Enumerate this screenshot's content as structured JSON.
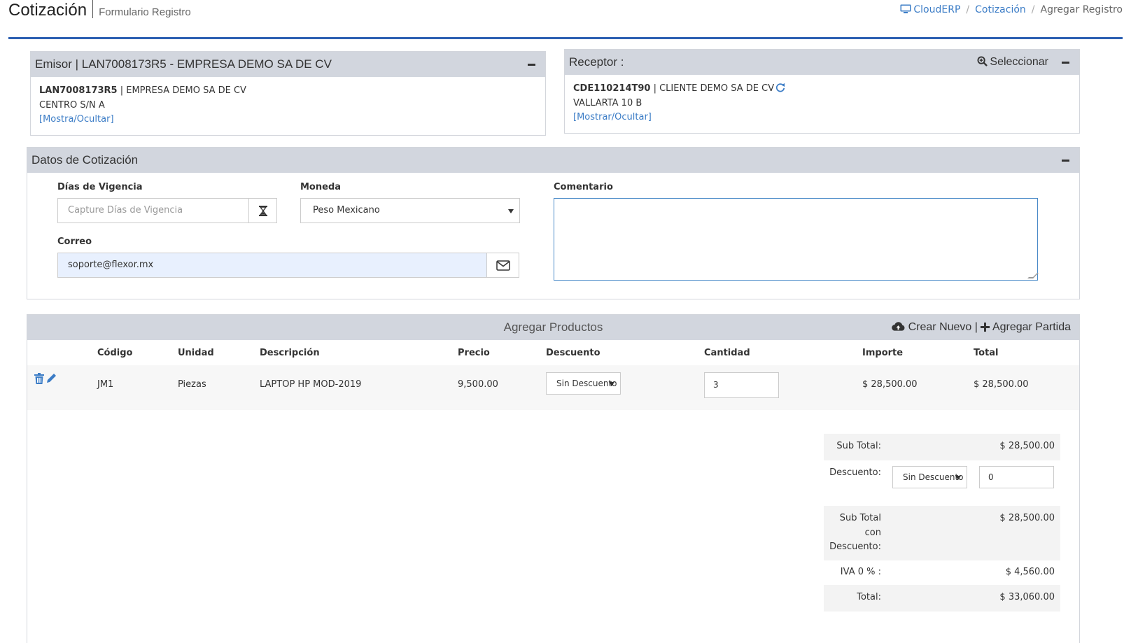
{
  "header": {
    "title": "Cotización",
    "subtitle": "Formulario Registro",
    "breadcrumb": {
      "home": "CloudERP",
      "section": "Cotización",
      "current": "Agregar Registro"
    }
  },
  "emisor": {
    "title": "Emisor | LAN7008173R5 - EMPRESA DEMO SA DE CV",
    "rfc": "LAN7008173R5",
    "name": " | EMPRESA DEMO SA DE CV",
    "address": "CENTRO S/N A",
    "toggle": "[Mostra/Ocultar]"
  },
  "receptor": {
    "title": "Receptor :",
    "select_label": "Seleccionar",
    "rfc": "CDE110214T90",
    "name": " | CLIENTE DEMO SA DE CV",
    "address": "VALLARTA 10 B",
    "toggle": "[Mostrar/Ocultar]"
  },
  "datos": {
    "title": "Datos de Cotización",
    "vigencia_label": "Días de Vigencia",
    "vigencia_placeholder": "Capture Días de Vigencia",
    "moneda_label": "Moneda",
    "moneda_value": "Peso Mexicano",
    "comentario_label": "Comentario",
    "correo_label": "Correo",
    "correo_value": "soporte@flexor.mx"
  },
  "productos": {
    "title": "Agregar Productos",
    "crear_nuevo": "Crear Nuevo",
    "separator": "|",
    "agregar_partida": "Agregar Partida",
    "columns": {
      "codigo": "Código",
      "unidad": "Unidad",
      "descripcion": "Descripción",
      "precio": "Precio",
      "descuento": "Descuento",
      "cantidad": "Cantidad",
      "importe": "Importe",
      "total": "Total"
    },
    "rows": [
      {
        "codigo": "JM1",
        "unidad": "Piezas",
        "descripcion": "LAPTOP HP MOD-2019",
        "precio": "9,500.00",
        "descuento": "Sin Descuento",
        "cantidad": "3",
        "importe": "$ 28,500.00",
        "total": "$ 28,500.00"
      }
    ]
  },
  "totales": {
    "subtotal_label": "Sub Total:",
    "subtotal": "$ 28,500.00",
    "descuento_label": "Descuento:",
    "descuento_select": "Sin Descuento",
    "descuento_value": "0",
    "subtotal_desc_label_1": "Sub Total",
    "subtotal_desc_label_2": "con",
    "subtotal_desc_label_3": "Descuento:",
    "subtotal_desc": "$ 28,500.00",
    "iva_label": "IVA 0 % :",
    "iva": "$ 4,560.00",
    "total_label": "Total:",
    "total": "$ 33,060.00"
  },
  "colors": {
    "accent": "#2c5fb2",
    "link": "#3b7cc6",
    "panel_header": "#d2d6de"
  }
}
